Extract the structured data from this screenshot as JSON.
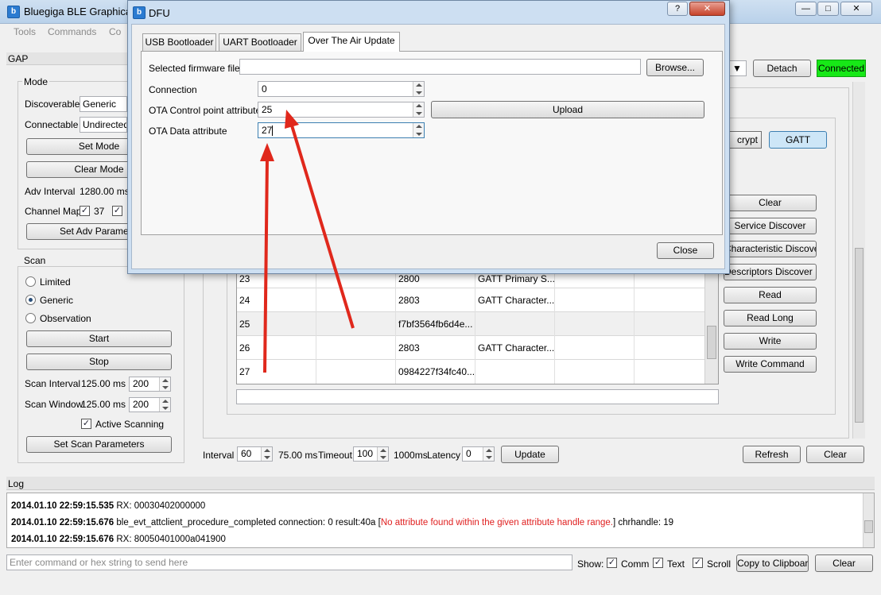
{
  "main": {
    "title": "Bluegiga BLE Graphical",
    "menu": [
      "Tools",
      "Commands",
      "Co"
    ],
    "win_controls": {
      "minimize": "▭",
      "maximize": "◻",
      "close": "✕"
    },
    "top": {
      "detach_label": "Detach",
      "status_label": "Connected"
    }
  },
  "gap": {
    "header": "GAP",
    "mode_label": "Mode",
    "discoverable_label": "Discoverable",
    "discoverable_value": "Generic",
    "connectable_label": "Connectable",
    "connectable_value": "Undirected",
    "set_mode_label": "Set Mode",
    "clear_mode_label": "Clear Mode",
    "adv_interval_label": "Adv Interval",
    "adv_interval_value": "1280.00 ms",
    "channel_map_label": "Channel Map",
    "channel_37": "37",
    "set_adv_label": "Set Adv Paramete",
    "scan_label": "Scan",
    "radio_limited": "Limited",
    "radio_generic": "Generic",
    "radio_observation": "Observation",
    "start_label": "Start",
    "stop_label": "Stop",
    "scan_interval_label": "Scan Interval",
    "scan_interval_ms": "125.00 ms",
    "scan_interval_value": "200",
    "scan_window_label": "Scan Window",
    "scan_window_ms": "125.00 ms",
    "scan_window_value": "200",
    "active_scanning_label": "Active Scanning",
    "set_scan_params_label": "Set Scan Parameters"
  },
  "gatt": {
    "encrypt_label": "crypt",
    "gatt_label": "GATT",
    "buttons": [
      "Clear",
      "Service Discover",
      "Characteristic Discover",
      "Descriptors Discover",
      "Read",
      "Read Long",
      "Write",
      "Write Command"
    ],
    "rows": [
      {
        "handle": "23",
        "uuid": "2800",
        "desc": "GATT Primary S..."
      },
      {
        "handle": "24",
        "uuid": "2803",
        "desc": "GATT Character..."
      },
      {
        "handle": "25",
        "uuid": "f7bf3564fb6d4e...",
        "desc": ""
      },
      {
        "handle": "26",
        "uuid": "2803",
        "desc": "GATT Character..."
      },
      {
        "handle": "27",
        "uuid": "0984227f34fc40...",
        "desc": ""
      }
    ]
  },
  "conn": {
    "interval_label": "Interval",
    "interval_value": "60",
    "interval_ms": "75.00 ms",
    "timeout_label": "Timeout",
    "timeout_value": "100",
    "timeout_ms": "1000ms",
    "latency_label": "Latency",
    "latency_value": "0",
    "update_label": "Update",
    "refresh_label": "Refresh",
    "clear_label": "Clear"
  },
  "log": {
    "header": "Log",
    "lines": [
      {
        "ts": "2014.01.10 22:59:15.535",
        "text": " RX: 00030402000000",
        "red": "",
        "tail": ""
      },
      {
        "ts": "2014.01.10 22:59:15.676",
        "text": " ble_evt_attclient_procedure_completed connection: 0 result:40a [",
        "red": "No attribute found within the given attribute handle range.",
        "tail": "] chrhandle: 19"
      },
      {
        "ts": "2014.01.10 22:59:15.676",
        "text": " RX: 80050401000a041900",
        "red": "",
        "tail": ""
      }
    ],
    "command_placeholder": "Enter command or hex string to send here",
    "show_label": "Show:",
    "comm_label": "Comm",
    "text_label": "Text",
    "scroll_label": "Scroll",
    "copy_label": "Copy to Clipboard",
    "clear_label": "Clear"
  },
  "dfu": {
    "title": "DFU",
    "help_label": "?",
    "close_x": "✕",
    "tabs": [
      "USB Bootloader",
      "UART Bootloader",
      "Over The Air Update"
    ],
    "firmware_label": "Selected firmware file:",
    "firmware_value": "",
    "browse_label": "Browse...",
    "connection_label": "Connection",
    "connection_value": "0",
    "ota_control_label": "OTA Control point attribute",
    "ota_control_value": "25",
    "upload_label": "Upload",
    "ota_data_label": "OTA Data attribute",
    "ota_data_value": "27",
    "close_label": "Close"
  },
  "colors": {
    "connected_bg": "#17e817",
    "arrow": "#e0281c",
    "gatt_active": "#cde6f7"
  }
}
